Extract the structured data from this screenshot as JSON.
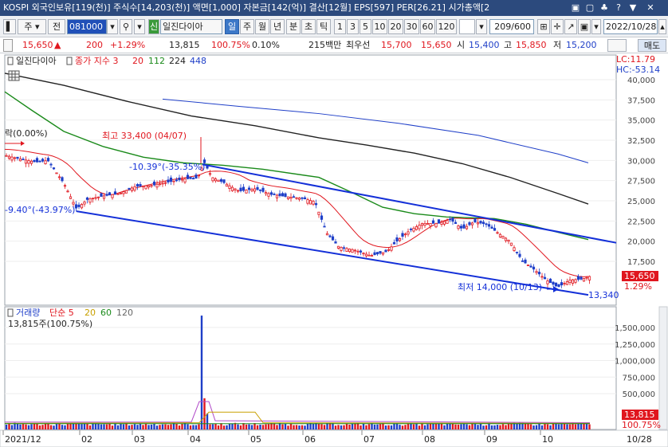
{
  "window": {
    "title": "KOSPI 외국인보유[119(천)] 주식수[14,203(천)] 액면[1,000] 자본금[142(억)] 결산[12월] EPS[597] PER[26.21] 시가총액[2",
    "buttons": [
      "▣",
      "▢",
      "♣",
      "?",
      "▼",
      "✕"
    ]
  },
  "toolbar": {
    "market_label": "주",
    "prev_label": "전",
    "code": "081000",
    "name_badge": "신",
    "name": "일진다이아",
    "periods": [
      "일",
      "주",
      "월",
      "년",
      "분",
      "초",
      "틱"
    ],
    "active_period": "일",
    "minutes": [
      "1",
      "3",
      "5",
      "10",
      "20",
      "30",
      "60",
      "120"
    ],
    "count": "209/600",
    "date": "2022/10/28",
    "buy_label": "매수"
  },
  "quote": {
    "price": "15,650",
    "arrow": "▲",
    "change": "200",
    "change_pct": "+1.29%",
    "volume": "13,815",
    "vol_ratio": "100.75%",
    "turnover": "0.10%",
    "amount": "215백만",
    "best_label": "최우선",
    "ask": "15,700",
    "bid": "15,650",
    "open_label": "시",
    "open": "15,400",
    "high_label": "고",
    "high": "15,850",
    "low_label": "저",
    "low": "15,200",
    "sell_label": "매도"
  },
  "price_panel": {
    "stock_name": "일진다이아",
    "ma_title": "종가 지수 3",
    "ma_periods": [
      {
        "label": "20",
        "color": "#e0161e"
      },
      {
        "label": "112",
        "color": "#1a8a1a"
      },
      {
        "label": "224",
        "color": "#222222"
      },
      {
        "label": "448",
        "color": "#1f3fc8"
      }
    ],
    "lc": "LC:11.79",
    "hc": "HC:-53.14",
    "yticks": [
      "40,000",
      "37,500",
      "35,000",
      "32,500",
      "30,000",
      "27,500",
      "25,000",
      "22,500",
      "20,000",
      "17,500"
    ],
    "current_price_tag": "15,650",
    "current_pct_tag": "1.29%",
    "annotations": {
      "left_pct": "락(0.00%)",
      "high_note": "최고 33,400 (04/07)",
      "trend1": "-10.39°(-35.35%)",
      "trend2": "-9.40°(-43.97%)",
      "low_note": "최저 14,000 (10/13)",
      "end_value": "13,340"
    }
  },
  "volume_panel": {
    "title": "거래량",
    "ma_label": "단순 5",
    "ma_periods": [
      {
        "label": "20",
        "color": "#c8a000"
      },
      {
        "label": "60",
        "color": "#1a8a1a"
      },
      {
        "label": "120",
        "color": "#666666"
      }
    ],
    "current": "13,815주(100.75%)",
    "yticks": [
      "1,500,000",
      "1,250,000",
      "1,000,000",
      "750,000",
      "500,000"
    ],
    "vol_tag": "13,815",
    "vol_pct_tag": "100.75%"
  },
  "xaxis": {
    "labels": [
      "2021/12",
      "02",
      "03",
      "04",
      "05",
      "06",
      "07",
      "08",
      "09",
      "10"
    ],
    "right_label": "10/28"
  },
  "colors": {
    "up": "#e0161e",
    "down": "#1f3fc8",
    "ma20": "#e0161e",
    "ma112": "#1a8a1a",
    "ma224": "#222222",
    "ma448": "#1f3fc8",
    "trendline": "#1430d8"
  }
}
